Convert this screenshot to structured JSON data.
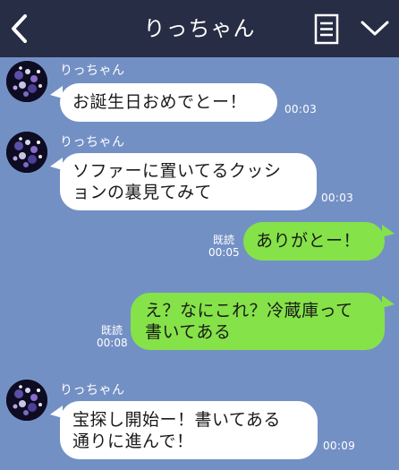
{
  "header": {
    "title": "りっちゃん"
  },
  "icons": {
    "back": "chevron-left-icon",
    "menu": "list-icon",
    "expand": "chevron-down-icon"
  },
  "colors": {
    "header_bg": "#262d44",
    "chat_bg": "#7390c5",
    "incoming_bubble": "#ffffff",
    "outgoing_bubble": "#85e249"
  },
  "messages": [
    {
      "direction": "in",
      "sender": "りっちゃん",
      "lines": [
        "お誕生日おめでとー！"
      ],
      "time": "00:03"
    },
    {
      "direction": "in",
      "sender": "りっちゃん",
      "lines": [
        "ソファーに置いてるクッシ",
        "ョンの裏見てみて"
      ],
      "time": "00:03"
    },
    {
      "direction": "out",
      "read": "既読",
      "lines": [
        "ありがとー！"
      ],
      "time": "00:05"
    },
    {
      "direction": "out",
      "read": "既読",
      "lines": [
        "え？なにこれ？冷蔵庫って",
        "書いてある"
      ],
      "time": "00:08"
    },
    {
      "direction": "in",
      "sender": "りっちゃん",
      "lines": [
        "宝探し開始ー！書いてある",
        "通りに進んで！"
      ],
      "time": "00:09"
    }
  ]
}
